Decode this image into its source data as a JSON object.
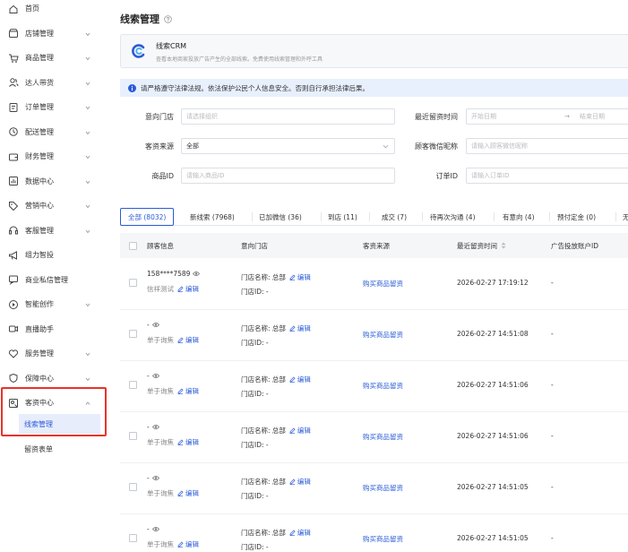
{
  "sidebar": {
    "items": [
      {
        "label": "首页",
        "icon": "home-icon",
        "caret": false
      },
      {
        "label": "店铺管理",
        "icon": "shop-icon",
        "caret": true
      },
      {
        "label": "商品管理",
        "icon": "cart-icon",
        "caret": true
      },
      {
        "label": "达人带货",
        "icon": "people-icon",
        "caret": true
      },
      {
        "label": "订单管理",
        "icon": "order-icon",
        "caret": true
      },
      {
        "label": "配送管理",
        "icon": "delivery-icon",
        "caret": true
      },
      {
        "label": "财务管理",
        "icon": "wallet-icon",
        "caret": true
      },
      {
        "label": "数据中心",
        "icon": "chart-icon",
        "caret": true
      },
      {
        "label": "营销中心",
        "icon": "tag-icon",
        "caret": true
      },
      {
        "label": "客服管理",
        "icon": "headset-icon",
        "caret": true
      },
      {
        "label": "组力智投",
        "icon": "megaphone-icon",
        "caret": false
      },
      {
        "label": "商业私信管理",
        "icon": "chat-icon",
        "caret": false
      },
      {
        "label": "智能创作",
        "icon": "play-icon",
        "caret": true
      },
      {
        "label": "直播助手",
        "icon": "camera-icon",
        "caret": false
      },
      {
        "label": "服务管理",
        "icon": "heart-icon",
        "caret": true
      },
      {
        "label": "保障中心",
        "icon": "shield-icon",
        "caret": true
      },
      {
        "label": "客资中心",
        "icon": "contacts-icon",
        "caret": true
      }
    ],
    "sub_items": [
      {
        "label": "线索管理"
      },
      {
        "label": "留资表单"
      }
    ]
  },
  "header": {
    "title": "线索管理"
  },
  "crm": {
    "title": "线索CRM",
    "desc": "查看本地商家投放广告产生的全部线索。免费使用线索管理和外呼工具"
  },
  "notice": "请严格遵守法律法规。依法保护公民个人信息安全。否则自行承担法律后果。",
  "filters": {
    "store_label": "意向门店",
    "store_placeholder": "请选择组织",
    "source_label": "客资来源",
    "source_value": "全部",
    "product_label": "商品ID",
    "product_placeholder": "请输入商品ID",
    "recent_label": "最近留资时间",
    "start_placeholder": "开始日期",
    "arrow": "→",
    "end_placeholder": "结束日期",
    "wechat_label": "顾客微信昵称",
    "wechat_placeholder": "请输入顾客微信昵称",
    "order_label": "订单ID",
    "order_placeholder": "请输入订单ID"
  },
  "tabs": [
    {
      "label": "全部 (8032)"
    },
    {
      "label": "新线索 (7968)"
    },
    {
      "label": "已加微信 (36)"
    },
    {
      "label": "到店 (11)"
    },
    {
      "label": "成交 (7)"
    },
    {
      "label": "待再次沟通 (4)"
    },
    {
      "label": "有意向 (4)"
    },
    {
      "label": "预付定金 (0)"
    },
    {
      "label": "无"
    }
  ],
  "table": {
    "columns": [
      "顾客信息",
      "意向门店",
      "客资来源",
      "最近留资时间",
      "广告投放账户ID"
    ],
    "rows": [
      {
        "name": "158****7589",
        "note": "信祥测试",
        "edit": "编辑",
        "store_name": "门店名称: 总部",
        "store_id": "门店ID: -",
        "source": "购买商品留资",
        "time": "2026-02-27 17:19:12",
        "ad": "-"
      },
      {
        "name": "-",
        "note": "单于询焦",
        "edit": "编辑",
        "store_name": "门店名称: 总部",
        "store_id": "门店ID: -",
        "source": "购买商品留资",
        "time": "2026-02-27 14:51:08",
        "ad": "-"
      },
      {
        "name": "-",
        "note": "单于询焦",
        "edit": "编辑",
        "store_name": "门店名称: 总部",
        "store_id": "门店ID: -",
        "source": "购买商品留资",
        "time": "2026-02-27 14:51:06",
        "ad": "-"
      },
      {
        "name": "-",
        "note": "单于询焦",
        "edit": "编辑",
        "store_name": "门店名称: 总部",
        "store_id": "门店ID: -",
        "source": "购买商品留资",
        "time": "2026-02-27 14:51:06",
        "ad": "-"
      },
      {
        "name": "-",
        "note": "单于询焦",
        "edit": "编辑",
        "store_name": "门店名称: 总部",
        "store_id": "门店ID: -",
        "source": "购买商品留资",
        "time": "2026-02-27 14:51:05",
        "ad": "-"
      },
      {
        "name": "-",
        "note": "单于询焦",
        "edit": "编辑",
        "store_name": "门店名称: 总部",
        "store_id": "门店ID: -",
        "source": "购买商品留资",
        "time": "2026-02-27 14:51:05",
        "ad": "-"
      }
    ]
  },
  "colors": {
    "accent": "#2a5bd7",
    "highlight": "#e8332a",
    "notice_bg": "#e8f0fd"
  }
}
